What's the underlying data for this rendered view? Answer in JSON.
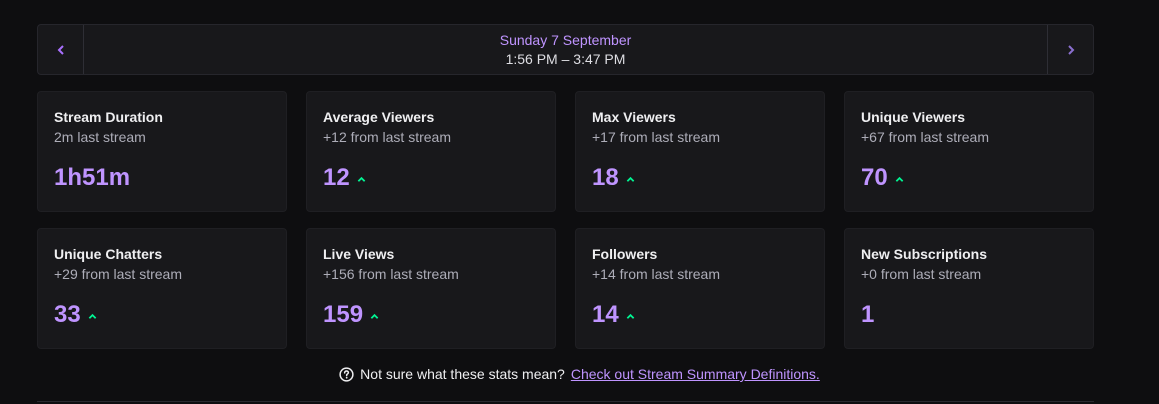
{
  "date_nav": {
    "date": "Sunday 7 September",
    "time_range": "1:56 PM – 3:47 PM",
    "prev_icon": "chevron-left-icon",
    "next_icon": "chevron-right-icon"
  },
  "stats": [
    {
      "title": "Stream Duration",
      "change": "2m last stream",
      "value": "1h51m",
      "trend": "none"
    },
    {
      "title": "Average Viewers",
      "change": "+12 from last stream",
      "value": "12",
      "trend": "up"
    },
    {
      "title": "Max Viewers",
      "change": "+17 from last stream",
      "value": "18",
      "trend": "up"
    },
    {
      "title": "Unique Viewers",
      "change": "+67 from last stream",
      "value": "70",
      "trend": "up"
    },
    {
      "title": "Unique Chatters",
      "change": "+29 from last stream",
      "value": "33",
      "trend": "up"
    },
    {
      "title": "Live Views",
      "change": "+156 from last stream",
      "value": "159",
      "trend": "up"
    },
    {
      "title": "Followers",
      "change": "+14 from last stream",
      "value": "14",
      "trend": "up"
    },
    {
      "title": "New Subscriptions",
      "change": "+0 from last stream",
      "value": "1",
      "trend": "none"
    }
  ],
  "footer": {
    "question": "Not sure what these stats mean?",
    "link_text": "Check out Stream Summary Definitions."
  },
  "colors": {
    "background": "#0e0e10",
    "card": "#18181b",
    "accent": "#bf94ff",
    "trend_up": "#00f593"
  }
}
